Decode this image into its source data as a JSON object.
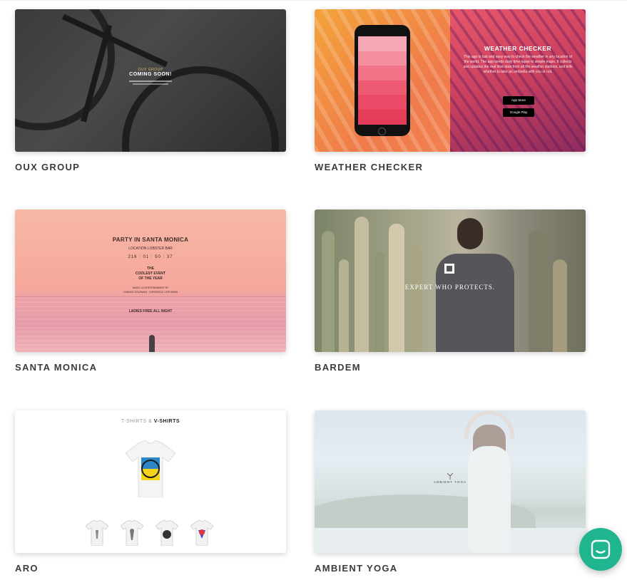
{
  "templates": [
    {
      "label": "OUX GROUP",
      "preview": {
        "brand": "OUX GROUP",
        "headline": "COMING SOON!"
      }
    },
    {
      "label": "WEATHER CHECKER",
      "preview": {
        "title": "WEATHER CHECKER",
        "body": "This app is fast and easy way to check the weather in any location of the world. The app sends daily time-lapse to simple maps. It collects and updates the real time data from all the weather stations, and tells whether to take an umbrella with you or not.",
        "app_store": "App Store",
        "google_play": "Google Play"
      }
    },
    {
      "label": "SANTA MONICA",
      "preview": {
        "title": "PARTY IN SANTA MONICA",
        "location": "LOCATION LOBSTER BAR",
        "countdown": "216 : 01 : 50 : 37",
        "tagline_1": "THE",
        "tagline_2": "COOLEST EVENT",
        "tagline_3": "OF THE YEAR",
        "music": "MUSIC & ENTERTAINMENT BY",
        "djs": "CHANCE COLEMAN · CHRONICLE LIVE BAND",
        "promo": "LADIES FREE ALL NIGHT"
      }
    },
    {
      "label": "BARDEM",
      "preview": {
        "headline": "EXPERT WHO PROTECTS."
      }
    },
    {
      "label": "ARO",
      "preview": {
        "title_light": "T-SHIRTS &",
        "title_bold": "V-SHIRTS"
      }
    },
    {
      "label": "AMBIENT YOGA",
      "preview": {
        "logo": "AMBIENT YOGA"
      }
    }
  ],
  "colors": {
    "label": "#3b3b3b",
    "chat_button": "#1fb58f"
  },
  "chat": {
    "icon": "chat-icon"
  }
}
